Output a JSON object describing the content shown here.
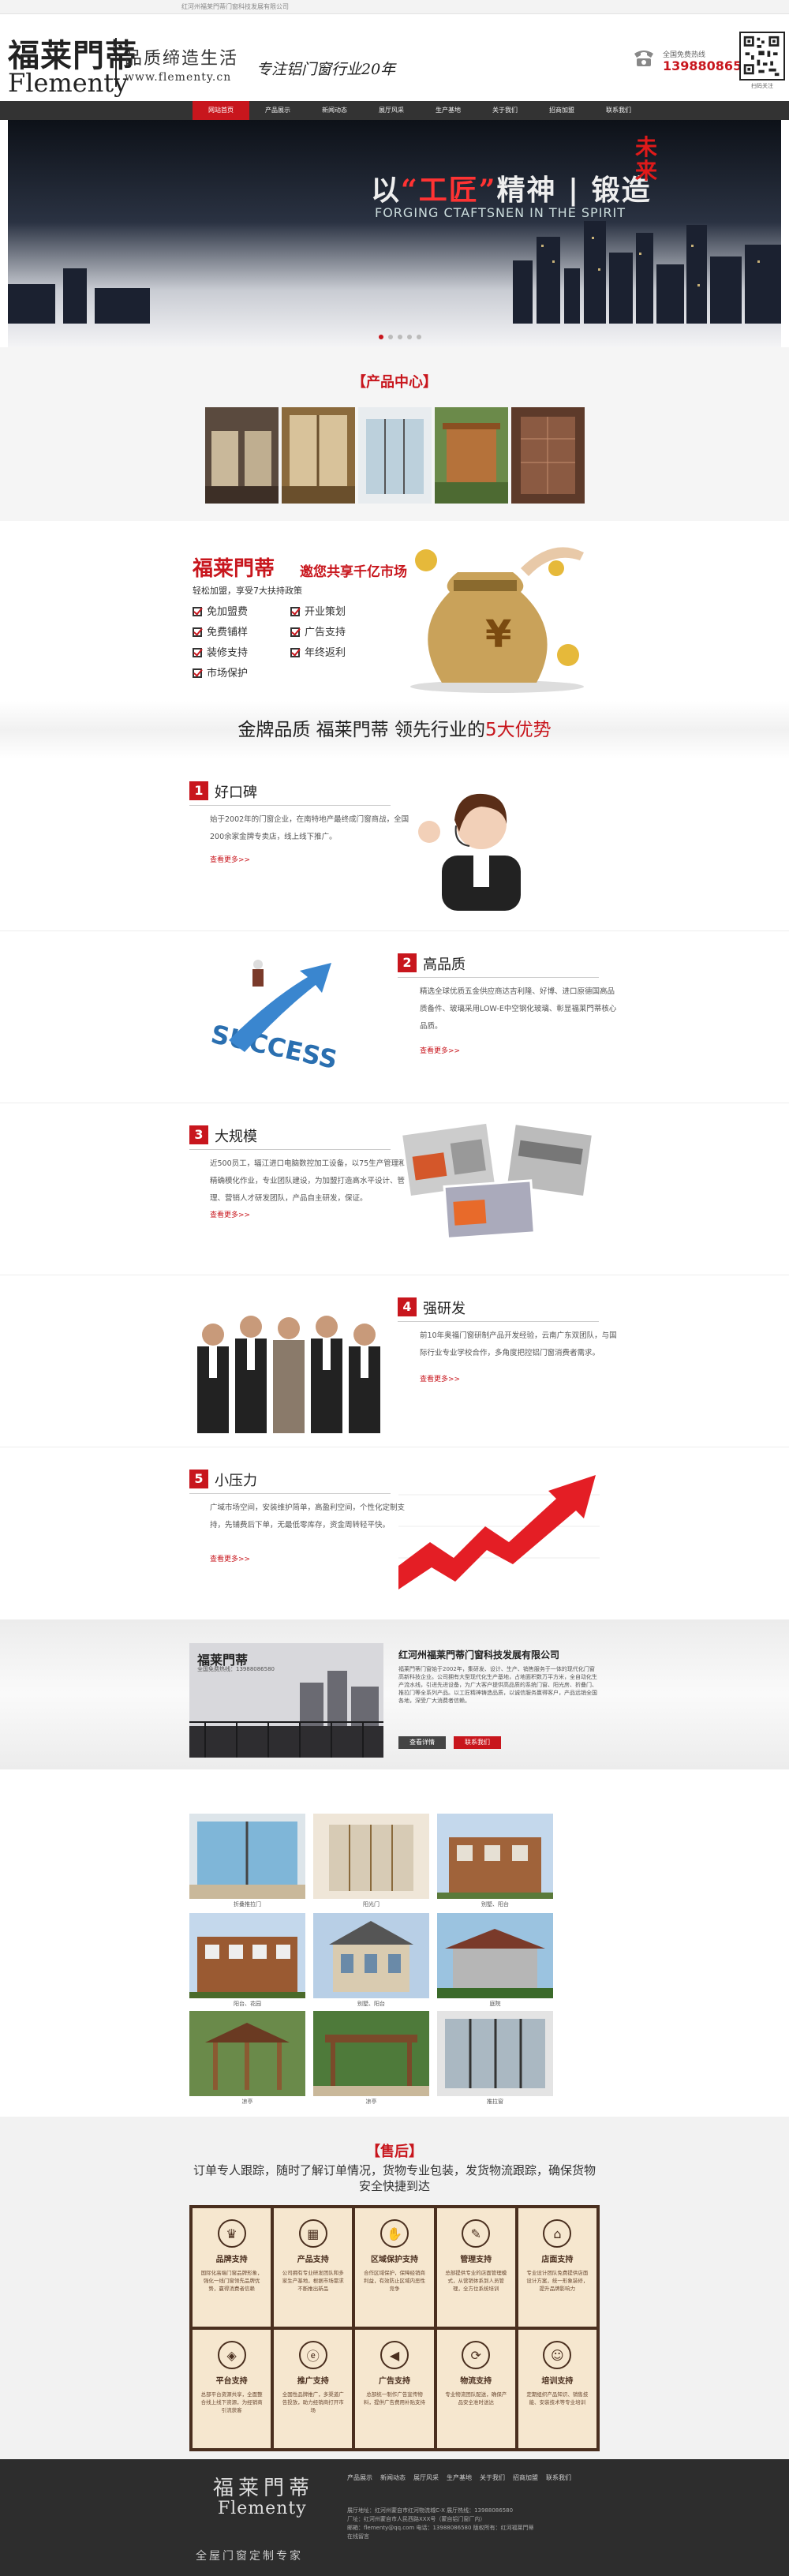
{
  "topbar": {
    "text": "红河州福莱門蒂门窗科技发展有限公司"
  },
  "header": {
    "logo_cn": "福莱門蒂",
    "logo_en": "Flementy",
    "slogan": "品质缔造生活",
    "url": "www.flementy.cn",
    "tagline": "专注铝门窗行业20年",
    "phone_label": "全国免费热线",
    "phone": "13988086580",
    "qr_label": "扫码关注"
  },
  "nav": [
    "网站首页",
    "产品展示",
    "新闻动态",
    "展厅风采",
    "生产基地",
    "关于我们",
    "招商加盟",
    "联系我们"
  ],
  "banner": {
    "title_pre": "以",
    "title_hl": "“工匠”",
    "title_post": "精神 | 锻造",
    "red": "未来",
    "subtitle": "FORGING CTAFTSNEN IN THE SPIRIT"
  },
  "products": {
    "title": "产品中心"
  },
  "promo": {
    "logo": "福莱門蒂",
    "headline": "邀您共享千亿市场",
    "sub": "轻松加盟，享受7大扶持政策",
    "items": [
      "免加盟费",
      "开业策划",
      "免费铺样",
      "广告支持",
      "装修支持",
      "年终返利",
      "市场保护"
    ]
  },
  "advantages": {
    "title_pre": "金牌品质  福莱門蒂  领先行业的",
    "title_hl": "5大优势",
    "items": [
      {
        "num": "1",
        "title": "好口碑",
        "text": "始于2002年的门窗企业，在南特地产最终成门窗商战，全国200余家金牌专卖店，线上线下推广。",
        "more": "查看更多>>"
      },
      {
        "num": "2",
        "title": "高品质",
        "text": "精选全球优质五金供应商达吉利隆、好博、进口原德国高品质备件、玻璃采用LOW-E中空钢化玻璃、彰显福莱門蒂核心品质。",
        "more": "查看更多>>"
      },
      {
        "num": "3",
        "title": "大规模",
        "text": "近500员工，辐江进口电脑数控加工设备，以75生产管理和精确模化作业，专业团队建设，为加盟打造高水平设计、管理、营销人才研发团队，产品自主研发，保证。",
        "more": "查看更多>>"
      },
      {
        "num": "4",
        "title": "强研发",
        "text": "前10年奥福门窗研制产品开发经验，云南广东双团队，与国际行业专业学校合作，多角度把控铝门窗消费者需求。",
        "more": "查看更多>>"
      },
      {
        "num": "5",
        "title": "小压力",
        "text": "广域市场空间，安装维护简单，高盈利空间，个性化定制支持，先铺费后下单，无最低零库存，资金周转轻平快。",
        "more": "查看更多>>"
      }
    ]
  },
  "company": {
    "logo": "福莱門蒂",
    "logo_sub": "全国免费热线：13988086580",
    "title": "红河州福莱門蒂门窗科技发展有限公司",
    "text": "福莱門蒂门窗始于2002年，集研发、设计、生产、销售服务于一体的现代化门窗高新科技企业。公司拥有大型现代化生产基地，占地面积数万平方米，全自动化生产流水线，引进先进设备，为广大客户提供高品质的系统门窗、阳光房、折叠门、推拉门等全系列产品。以工匠精神铸造品质，以诚信服务赢得客户，产品远销全国各地，深受广大消费者信赖。",
    "btn_more": "查看详情",
    "btn_contact": "联系我们"
  },
  "gallery": [
    "折叠推拉门",
    "阳光门",
    "别墅、阳台",
    "阳台、花园",
    "别墅、阳台",
    "庭院",
    "凉亭",
    "凉亭",
    "推拉窗"
  ],
  "after_sale": {
    "title": "售后",
    "subtitle": "订单专人跟踪，随时了解订单情况，货物专业包装，发货物流跟踪，确保货物安全快捷到达",
    "services": [
      {
        "icon": "crown-icon",
        "glyph": "♛",
        "title": "品牌支持",
        "text": "国际化高端门窗品牌形象，强化一线门窗领先品牌优势，赢得消费者信赖"
      },
      {
        "icon": "grid-icon",
        "glyph": "▦",
        "title": "产品支持",
        "text": "公司拥有专业研发团队和多家生产基地，根据市场需求不断推出新品"
      },
      {
        "icon": "handshake-icon",
        "glyph": "✋",
        "title": "区域保护支持",
        "text": "合作区域保护，保障经销商利益，有效防止区域内恶性竞争"
      },
      {
        "icon": "doc-icon",
        "glyph": "✎",
        "title": "管理支持",
        "text": "总部提供专业的店面管理模式，从营销体系到人员管理，全方位系统培训"
      },
      {
        "icon": "store-icon",
        "glyph": "⌂",
        "title": "店面支持",
        "text": "专业设计团队免费提供店面设计方案，统一形象装修，提升品牌影响力"
      },
      {
        "icon": "cube-icon",
        "glyph": "◈",
        "title": "平台支持",
        "text": "总部平台资源共享，全面整合线上线下资源，为经销商引流获客"
      },
      {
        "icon": "e-icon",
        "glyph": "ⓔ",
        "title": "推广支持",
        "text": "全国性品牌推广，多渠道广告投放，助力经销商打开市场"
      },
      {
        "icon": "speaker-icon",
        "glyph": "◀",
        "title": "广告支持",
        "text": "总部统一制作广告宣传物料，提供广告费用补贴支持"
      },
      {
        "icon": "truck-icon",
        "glyph": "⟳",
        "title": "物流支持",
        "text": "专业物流团队配送，确保产品安全准时送达"
      },
      {
        "icon": "people-icon",
        "glyph": "☺",
        "title": "培训支持",
        "text": "定期组织产品知识、销售技能、安装技术等专业培训"
      }
    ]
  },
  "footer": {
    "logo": "福莱門蒂",
    "logo_en": "Flementy",
    "sub": "全屋门窗定制专家",
    "nav": [
      "产品展示",
      "新闻动态",
      "展厅风采",
      "生产基地",
      "关于我们",
      "招商加盟",
      "联系我们"
    ],
    "info": [
      "展厅地址：红河州蒙自市红河物流城C-X   展厅热线：13988086580",
      "厂址：红河州蒙自市人民西路XXX号（蒙自铝门窗厂内）",
      "邮箱：flementy@qq.com    电话：13988086580   版权所有：红河福莱門蒂",
      "在线留言"
    ]
  }
}
